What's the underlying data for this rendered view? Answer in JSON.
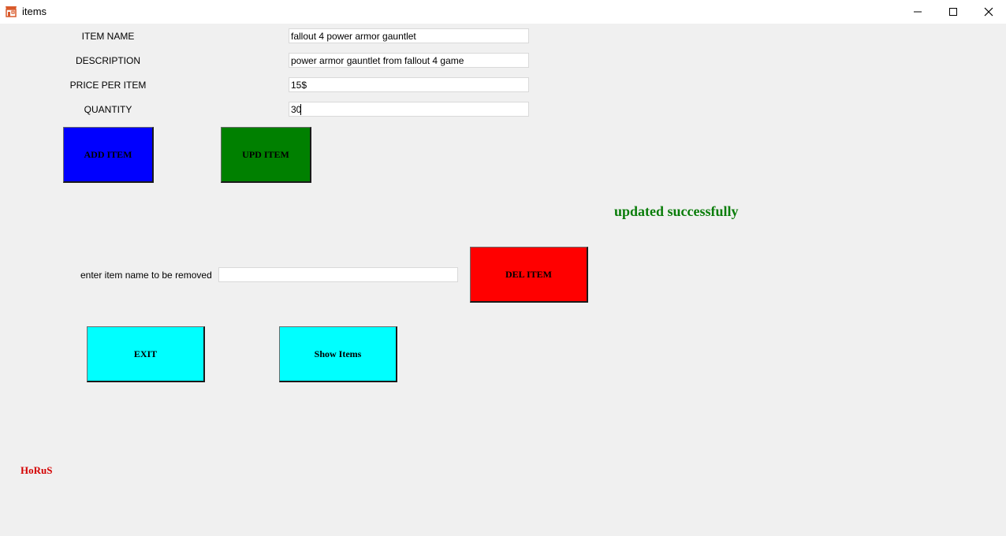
{
  "window": {
    "title": "items",
    "app_icon": "store-icon",
    "controls": {
      "minimize_icon": "minimize-icon",
      "maximize_icon": "maximize-icon",
      "close_icon": "close-icon"
    }
  },
  "form": {
    "item_name_label": "ITEM NAME",
    "item_name_value": "fallout 4 power armor gauntlet",
    "description_label": "DESCRIPTION",
    "description_value": "power armor gauntlet from fallout 4 game",
    "price_label": "PRICE PER ITEM",
    "price_value": "15$",
    "quantity_label": "QUANTITY",
    "quantity_value": "30"
  },
  "buttons": {
    "add_item": "ADD ITEM",
    "upd_item": "UPD ITEM",
    "del_item": "DEL ITEM",
    "exit": "EXIT",
    "show_items": "Show Items"
  },
  "status": {
    "message": "updated successfully",
    "color": "#0a7d0a"
  },
  "remove": {
    "label": "enter item name to be removed",
    "value": ""
  },
  "signature": "HoRuS",
  "colors": {
    "add_button": "#0000ff",
    "upd_button": "#008000",
    "del_button": "#ff0000",
    "exit_button": "#00ffff",
    "show_button": "#00ffff",
    "signature": "#d40000"
  }
}
